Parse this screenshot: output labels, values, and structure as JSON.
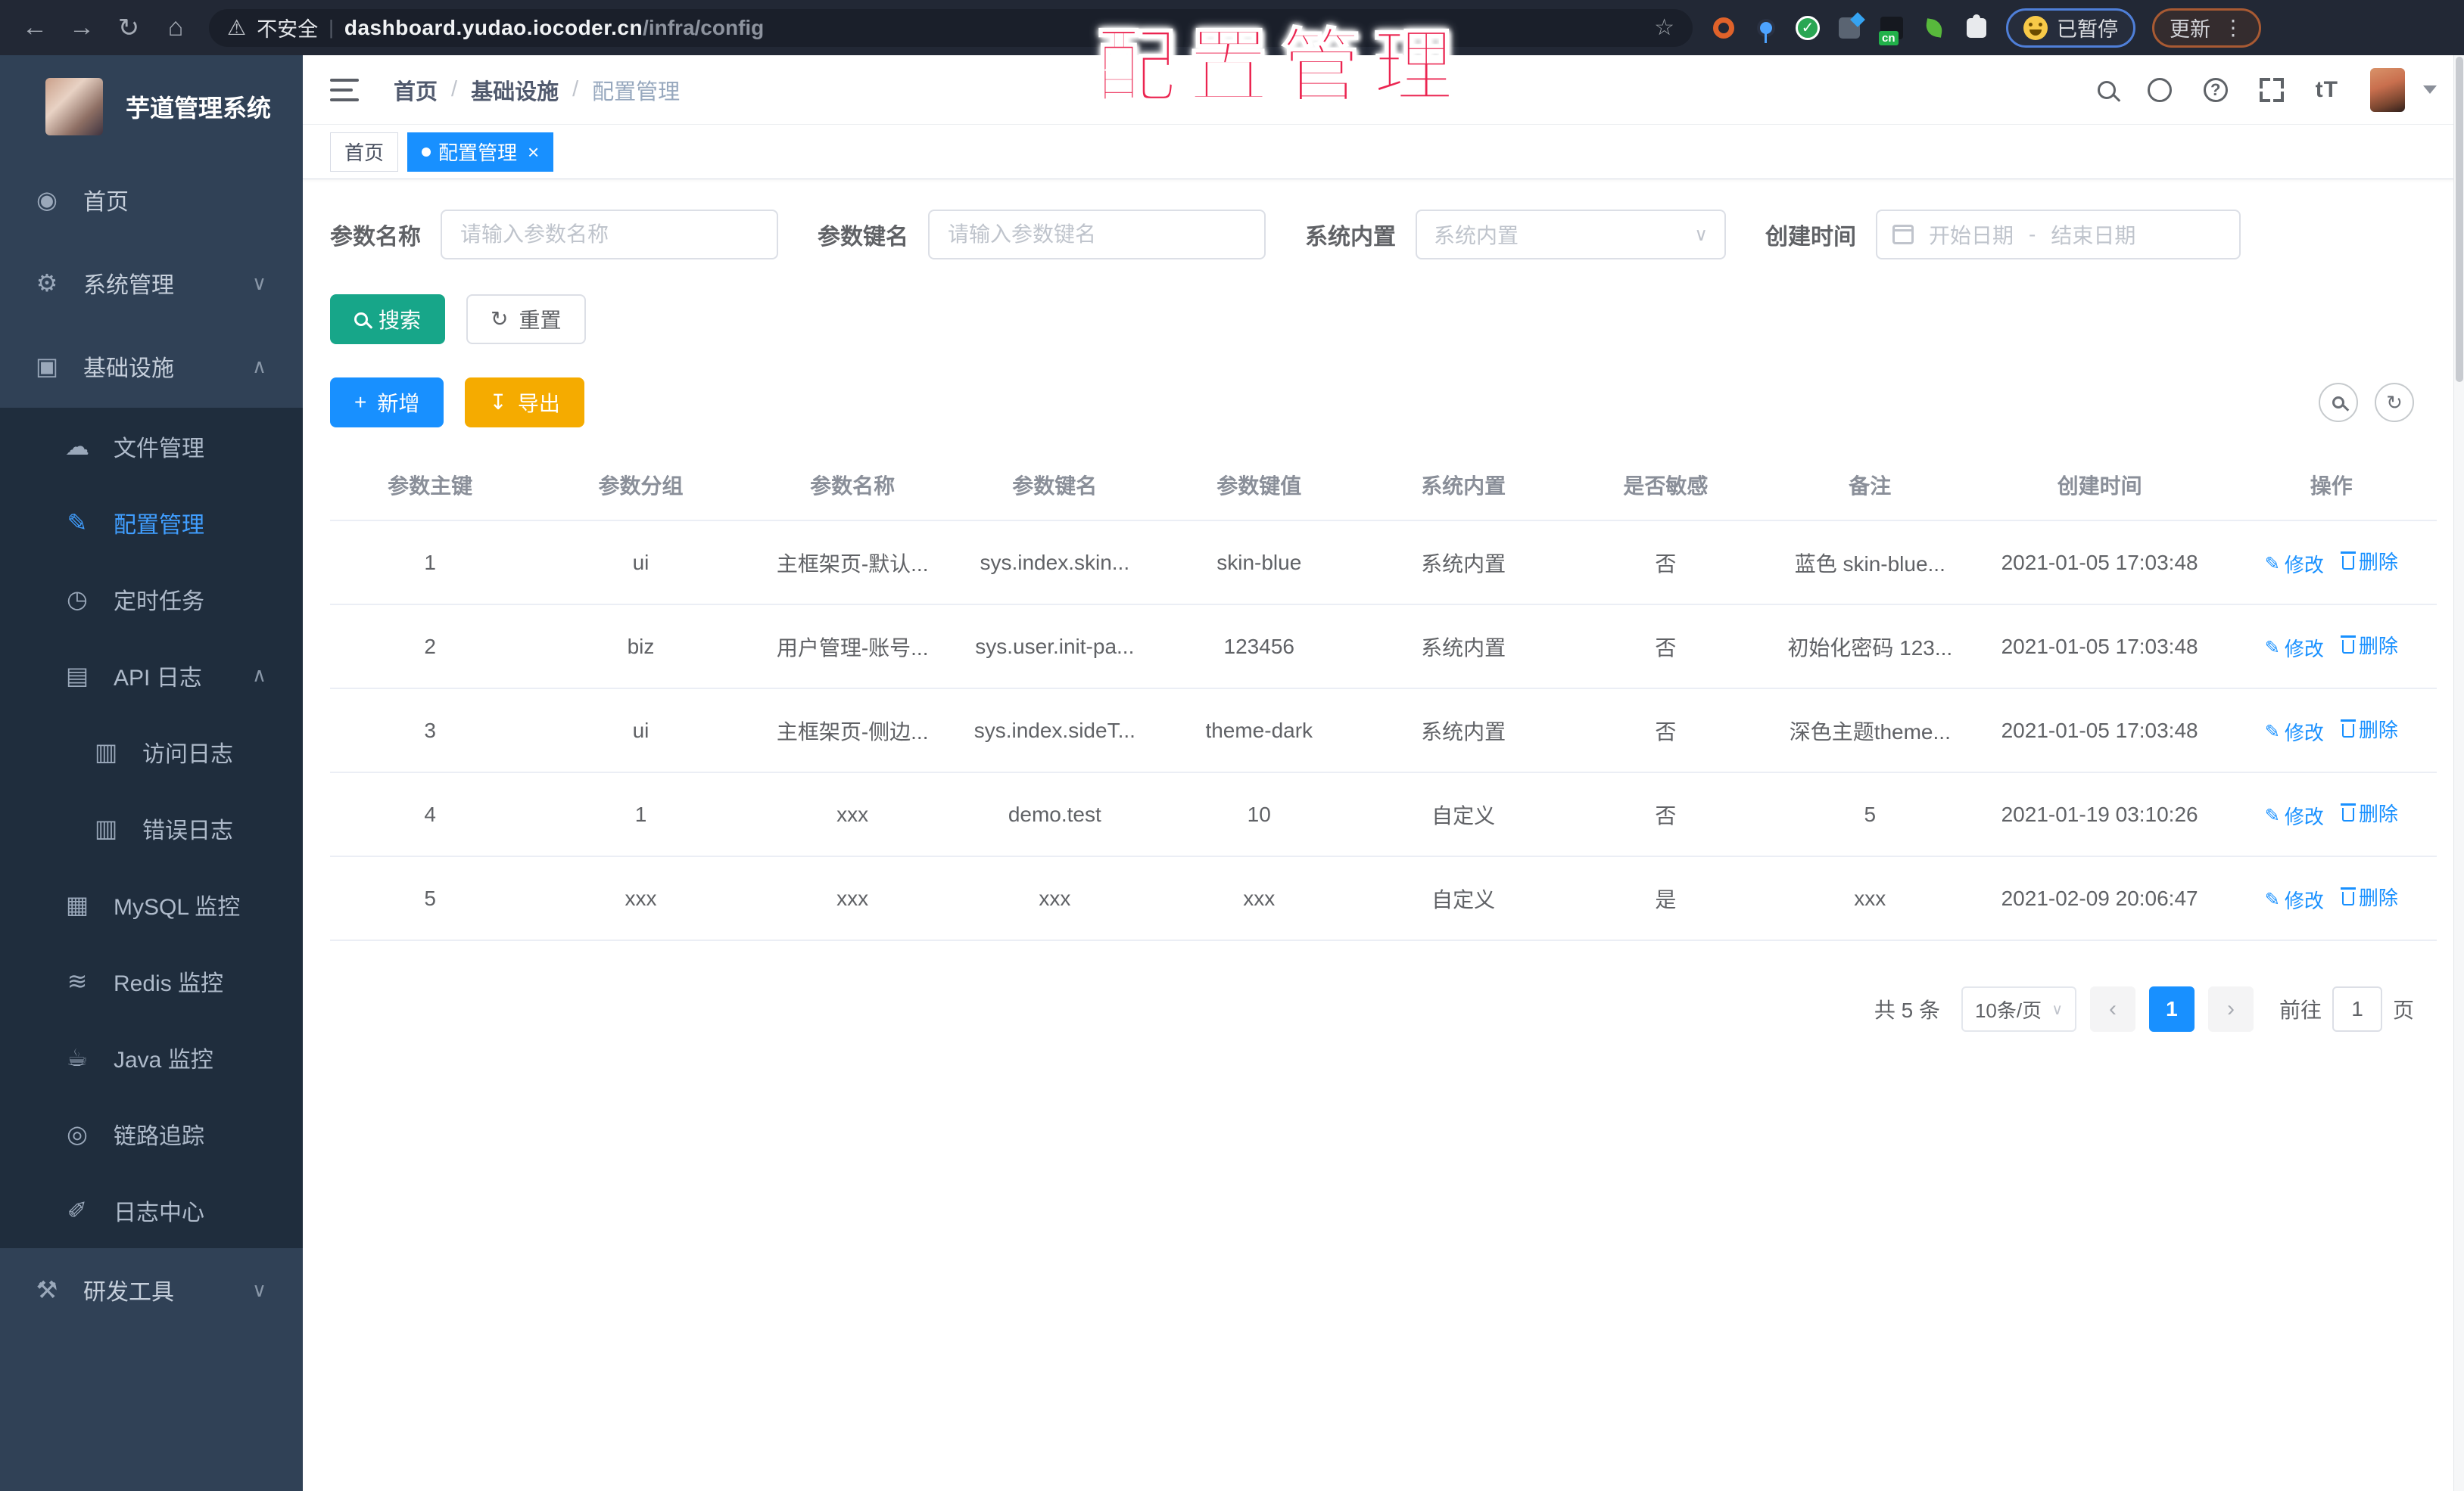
{
  "browser": {
    "security_label": "不安全",
    "url_host": "dashboard.yudao.iocoder.cn",
    "url_path": "/infra/config",
    "paused_badge": "已暂停",
    "update_badge": "更新",
    "menu_dots": "⋮",
    "nav_icons": [
      "back-icon",
      "forward-icon",
      "reload-icon",
      "home-icon"
    ],
    "ext_icons": [
      "bookmark-star-icon",
      "orange-ring-extension-icon",
      "pin-extension-icon",
      "green-check-extension-icon",
      "grid-extension-icon",
      "cn-extension-icon",
      "leaf-extension-icon",
      "puzzle-extensions-icon"
    ]
  },
  "overlay_title": "配置管理",
  "sidebar": {
    "app_title": "芋道管理系统",
    "items": [
      {
        "label": "首页",
        "icon": "dashboard-icon",
        "level": 1,
        "zone": "light"
      },
      {
        "label": "系统管理",
        "icon": "gear-icon",
        "level": 1,
        "zone": "light",
        "chevron": "down"
      },
      {
        "label": "基础设施",
        "icon": "infra-monitor-icon",
        "level": 1,
        "zone": "light",
        "chevron": "up"
      },
      {
        "label": "文件管理",
        "icon": "cloud-upload-icon",
        "level": 2,
        "zone": "dark"
      },
      {
        "label": "配置管理",
        "icon": "edit-icon",
        "level": 2,
        "zone": "dark",
        "active": true
      },
      {
        "label": "定时任务",
        "icon": "timer-icon",
        "level": 2,
        "zone": "dark"
      },
      {
        "label": "API 日志",
        "icon": "api-log-icon",
        "level": 2,
        "zone": "dark",
        "chevron": "up"
      },
      {
        "label": "访问日志",
        "icon": "access-log-icon",
        "level": 3,
        "zone": "dark"
      },
      {
        "label": "错误日志",
        "icon": "error-log-icon",
        "level": 3,
        "zone": "dark"
      },
      {
        "label": "MySQL 监控",
        "icon": "mysql-monitor-icon",
        "level": 2,
        "zone": "dark"
      },
      {
        "label": "Redis 监控",
        "icon": "redis-monitor-icon",
        "level": 2,
        "zone": "dark"
      },
      {
        "label": "Java 监控",
        "icon": "java-monitor-icon",
        "level": 2,
        "zone": "dark"
      },
      {
        "label": "链路追踪",
        "icon": "trace-eye-icon",
        "level": 2,
        "zone": "dark"
      },
      {
        "label": "日志中心",
        "icon": "log-center-icon",
        "level": 2,
        "zone": "dark"
      },
      {
        "label": "研发工具",
        "icon": "toolbox-icon",
        "level": 1,
        "zone": "light",
        "chevron": "down"
      }
    ]
  },
  "breadcrumb": [
    "首页",
    "基础设施",
    "配置管理"
  ],
  "tags": {
    "home": "首页",
    "active": "配置管理",
    "close": "×"
  },
  "filters": {
    "name_label": "参数名称",
    "name_placeholder": "请输入参数名称",
    "key_label": "参数键名",
    "key_placeholder": "请输入参数键名",
    "type_label": "系统内置",
    "type_placeholder": "系统内置",
    "date_label": "创建时间",
    "date_start_placeholder": "开始日期",
    "date_separator": "-",
    "date_end_placeholder": "结束日期"
  },
  "toolbar": {
    "search_label": "搜索",
    "reset_label": "重置",
    "add_label": "新增",
    "export_label": "导出"
  },
  "table": {
    "headers": [
      "参数主键",
      "参数分组",
      "参数名称",
      "参数键名",
      "参数键值",
      "系统内置",
      "是否敏感",
      "备注",
      "创建时间",
      "操作"
    ],
    "edit_label": "修改",
    "delete_label": "删除",
    "rows": [
      {
        "id": "1",
        "group": "ui",
        "name": "主框架页-默认...",
        "key": "sys.index.skin...",
        "value": "skin-blue",
        "type": "系统内置",
        "sensitive": "否",
        "remark": "蓝色 skin-blue...",
        "created": "2021-01-05 17:03:48"
      },
      {
        "id": "2",
        "group": "biz",
        "name": "用户管理-账号...",
        "key": "sys.user.init-pa...",
        "value": "123456",
        "type": "系统内置",
        "sensitive": "否",
        "remark": "初始化密码 123...",
        "created": "2021-01-05 17:03:48"
      },
      {
        "id": "3",
        "group": "ui",
        "name": "主框架页-侧边...",
        "key": "sys.index.sideT...",
        "value": "theme-dark",
        "type": "系统内置",
        "sensitive": "否",
        "remark": "深色主题theme...",
        "created": "2021-01-05 17:03:48"
      },
      {
        "id": "4",
        "group": "1",
        "name": "xxx",
        "key": "demo.test",
        "value": "10",
        "type": "自定义",
        "sensitive": "否",
        "remark": "5",
        "created": "2021-01-19 03:10:26"
      },
      {
        "id": "5",
        "group": "xxx",
        "name": "xxx",
        "key": "xxx",
        "value": "xxx",
        "type": "自定义",
        "sensitive": "是",
        "remark": "xxx",
        "created": "2021-02-09 20:06:47"
      }
    ]
  },
  "pagination": {
    "total": "共 5 条",
    "page_size": "10条/页",
    "current_page": "1",
    "goto_label": "前往",
    "goto_value": "1",
    "page_unit": "页"
  },
  "colors": {
    "accent_blue": "#1890ff",
    "active_link": "#409eff",
    "search_teal": "#17a689",
    "export_amber": "#f5ab00",
    "sidebar_bg": "#304156",
    "submenu_bg": "#1f2d3d",
    "overlay_red": "#eb2450",
    "chrome_bar": "#222835"
  }
}
